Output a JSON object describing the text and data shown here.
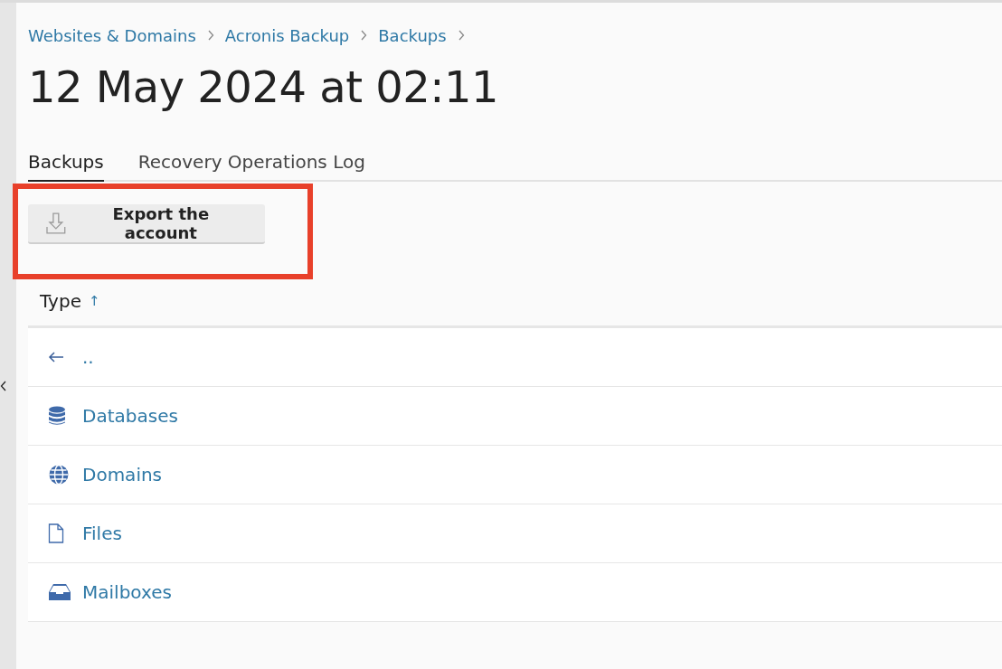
{
  "breadcrumbs": [
    "Websites & Domains",
    "Acronis Backup",
    "Backups"
  ],
  "title": "12 May 2024 at 02:11",
  "tabs": [
    {
      "label": "Backups",
      "selected": true
    },
    {
      "label": "Recovery Operations Log",
      "selected": false
    }
  ],
  "toolbar": {
    "button": "Export the account",
    "highlighted": true
  },
  "table": {
    "column": "Type",
    "sort_indicator": "↑",
    "rows": [
      {
        "kind": "up",
        "label": ".."
      },
      {
        "kind": "database",
        "label": "Databases"
      },
      {
        "kind": "globe",
        "label": "Domains"
      },
      {
        "kind": "file",
        "label": "Files"
      },
      {
        "kind": "inbox",
        "label": "Mailboxes"
      }
    ]
  }
}
